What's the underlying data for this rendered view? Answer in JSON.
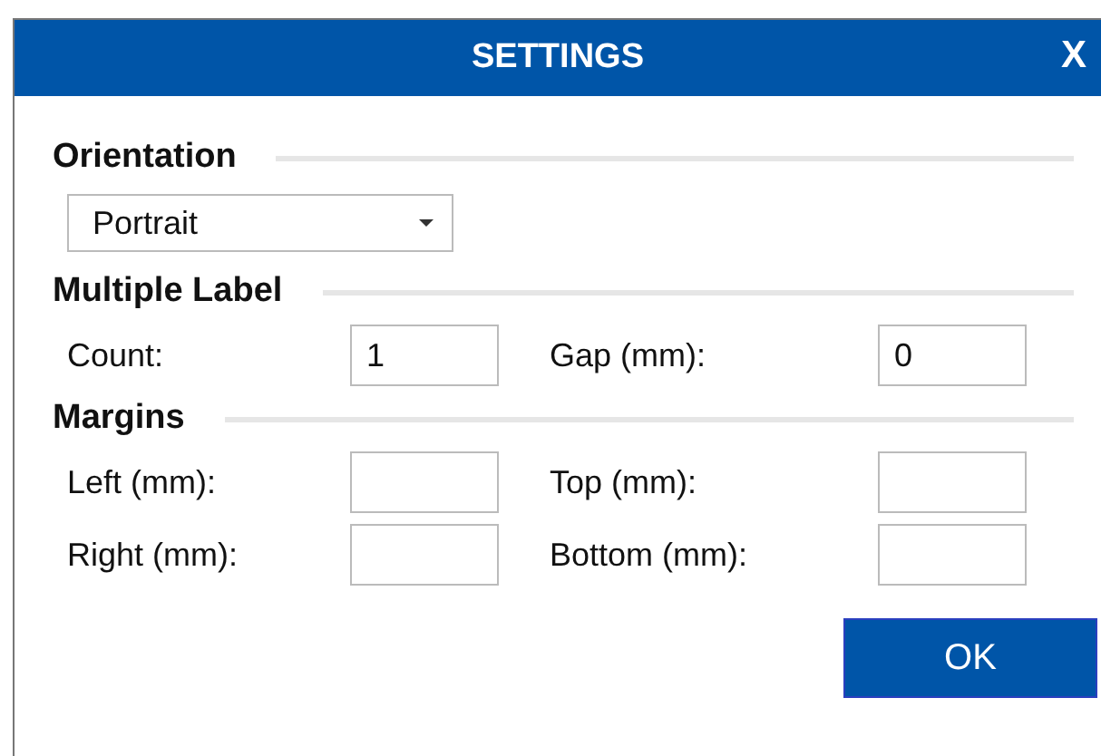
{
  "window": {
    "title": "SETTINGS",
    "close": "X"
  },
  "sections": [
    {
      "heading": "Orientation",
      "kind": "select",
      "value": "Portrait"
    },
    {
      "heading": "Multiple Label",
      "kind": "fields",
      "fields": [
        {
          "label": "Count:",
          "value": "1"
        },
        {
          "label": "Gap (mm):",
          "value": "0"
        }
      ]
    },
    {
      "heading": "Margins",
      "kind": "fields",
      "fields": [
        {
          "label": "Left (mm):"
        },
        {
          "label": "Top (mm):"
        },
        {
          "label": "Right (mm):"
        },
        {
          "label": "Bottom (mm):"
        }
      ]
    }
  ],
  "buttons": [
    "OK"
  ]
}
